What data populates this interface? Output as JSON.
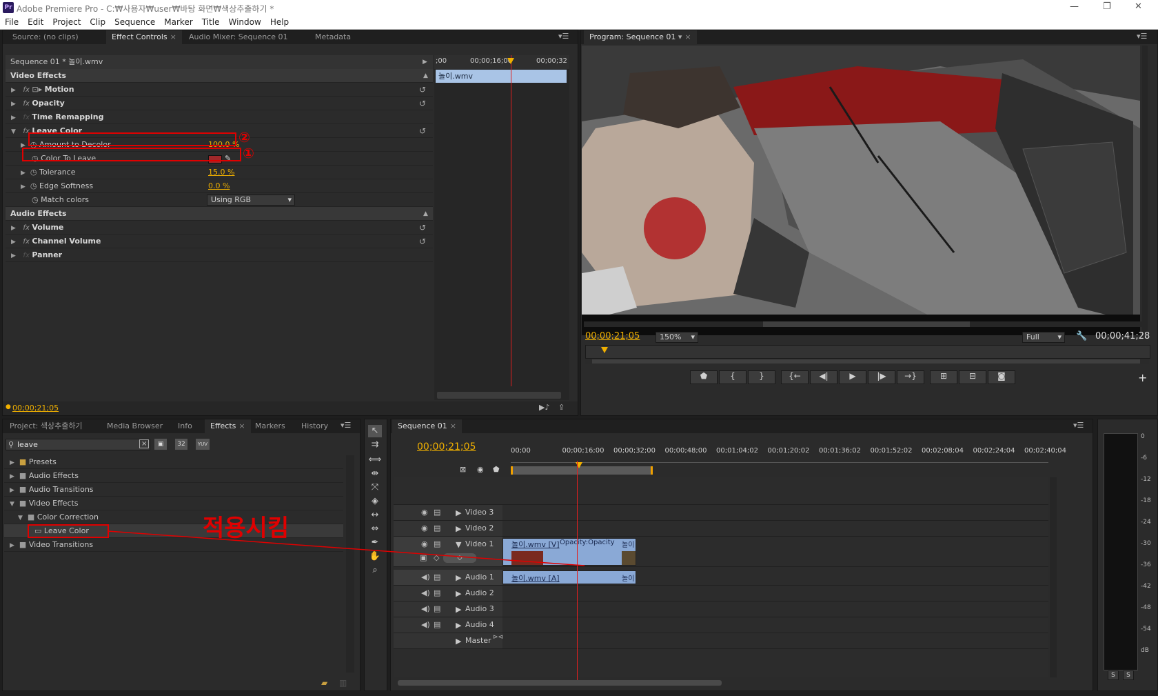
{
  "app": {
    "title": "Adobe Premiere Pro - C:₩사용자₩user₩바탕 화면₩색상추출하기 *",
    "logo": "Pr"
  },
  "window_controls": {
    "minimize": "—",
    "restore": "❐",
    "close": "✕"
  },
  "menu": [
    "File",
    "Edit",
    "Project",
    "Clip",
    "Sequence",
    "Marker",
    "Title",
    "Window",
    "Help"
  ],
  "source_panel": {
    "tabs": [
      "Source: (no clips)",
      "Effect Controls",
      "Audio Mixer: Sequence 01",
      "Metadata"
    ],
    "active_tab": "Effect Controls",
    "clip_path": "Sequence 01 * 놀이.wmv",
    "ruler": {
      "t0": ";00",
      "t1": "00;00;16;00",
      "t2": "00;00;32"
    },
    "clip_bar": "놀이.wmv",
    "video_effects_label": "Video Effects",
    "effects": [
      {
        "name": "Motion"
      },
      {
        "name": "Opacity"
      },
      {
        "name": "Time Remapping"
      },
      {
        "name": "Leave Color"
      }
    ],
    "params": {
      "amount": {
        "label": "Amount to Decolor",
        "value": "100.0 %"
      },
      "color_to_leave": {
        "label": "Color To Leave",
        "swatch": "#a0282a"
      },
      "tolerance": {
        "label": "Tolerance",
        "value": "15.0 %"
      },
      "edge_softness": {
        "label": "Edge Softness",
        "value": "0.0 %"
      },
      "match_colors": {
        "label": "Match colors",
        "value": "Using RGB"
      }
    },
    "audio_effects_label": "Audio Effects",
    "audio_effects": [
      {
        "name": "Volume"
      },
      {
        "name": "Channel Volume"
      },
      {
        "name": "Panner"
      }
    ],
    "annotation_1": "①",
    "annotation_2": "②",
    "timecode": "00;00;21;05"
  },
  "program_panel": {
    "tab": "Program: Sequence 01",
    "current_time": "00;00;21;05",
    "zoom": "150%",
    "quality": "Full",
    "duration": "00;00;41;28"
  },
  "project_panel": {
    "tabs": [
      "Project: 색상추출하기",
      "Media Browser",
      "Info",
      "Effects",
      "Markers",
      "History"
    ],
    "active_tab": "Effects",
    "search_value": "leave",
    "badges": [
      "32",
      "YUV"
    ],
    "tree": [
      {
        "label": "Presets",
        "level": 0,
        "open": false
      },
      {
        "label": "Audio Effects",
        "level": 0,
        "open": false
      },
      {
        "label": "Audio Transitions",
        "level": 0,
        "open": false
      },
      {
        "label": "Video Effects",
        "level": 0,
        "open": true
      },
      {
        "label": "Color Correction",
        "level": 1,
        "open": true
      },
      {
        "label": "Leave Color",
        "level": 2,
        "open": false
      },
      {
        "label": "Video Transitions",
        "level": 0,
        "open": false
      }
    ],
    "annotation": "적용시킴"
  },
  "timeline_panel": {
    "tab": "Sequence 01",
    "timecode": "00;00;21;05",
    "ruler": [
      "00;00",
      "00;00;16;00",
      "00;00;32;00",
      "00;00;48;00",
      "00;01;04;02",
      "00;01;20;02",
      "00;01;36;02",
      "00;01;52;02",
      "00;02;08;04",
      "00;02;24;04",
      "00;02;40;04"
    ],
    "video_tracks": [
      "Video 3",
      "Video 2",
      "Video 1"
    ],
    "audio_tracks": [
      "Audio 1",
      "Audio 2",
      "Audio 3",
      "Audio 4",
      "Master"
    ],
    "video_clip": "놀이.wmv [V]",
    "video_clip_fx": "Opacity:Opacity",
    "video_clip_end": "놀이",
    "audio_clip": "놀이.wmv [A]",
    "audio_clip_end": "놀이"
  },
  "meter": {
    "scale": [
      "0",
      "-6",
      "-12",
      "-18",
      "-24",
      "-30",
      "-36",
      "-42",
      "-48",
      "-54",
      "dB"
    ],
    "solo": [
      "S",
      "S"
    ]
  }
}
